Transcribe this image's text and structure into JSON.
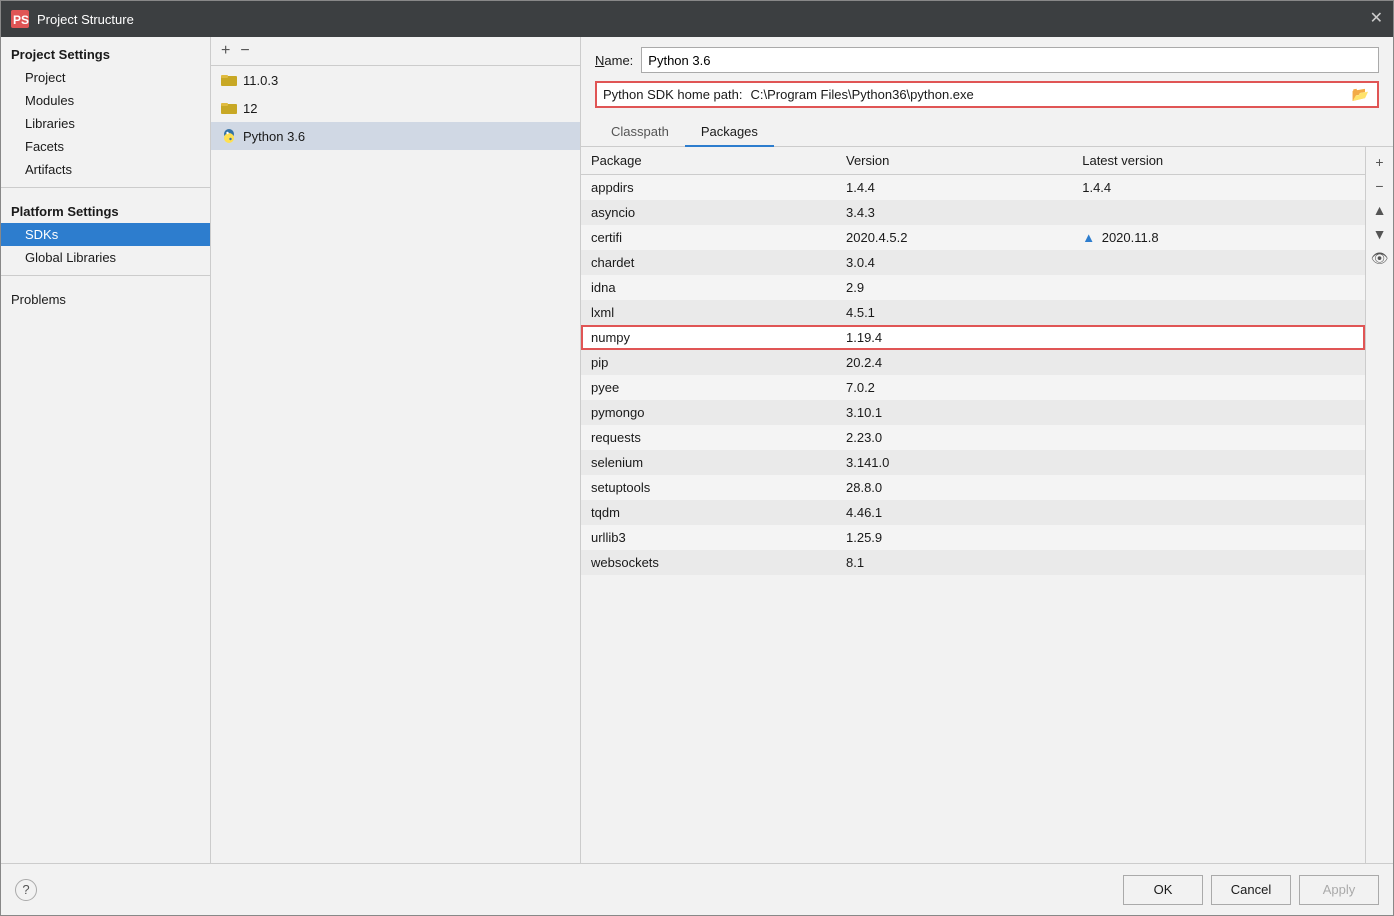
{
  "titleBar": {
    "title": "Project Structure",
    "closeLabel": "✕"
  },
  "sidebar": {
    "projectSettingsLabel": "Project Settings",
    "items": [
      {
        "id": "project",
        "label": "Project"
      },
      {
        "id": "modules",
        "label": "Modules"
      },
      {
        "id": "libraries",
        "label": "Libraries"
      },
      {
        "id": "facets",
        "label": "Facets"
      },
      {
        "id": "artifacts",
        "label": "Artifacts"
      }
    ],
    "platformSettingsLabel": "Platform Settings",
    "platformItems": [
      {
        "id": "sdks",
        "label": "SDKs",
        "active": true
      },
      {
        "id": "global-libraries",
        "label": "Global Libraries"
      }
    ],
    "problemsLabel": "Problems"
  },
  "sdkList": {
    "addLabel": "+",
    "removeLabel": "−",
    "items": [
      {
        "id": "11.0.3",
        "label": "11.0.3",
        "type": "folder"
      },
      {
        "id": "12",
        "label": "12",
        "type": "folder"
      },
      {
        "id": "python3.6",
        "label": "Python 3.6",
        "type": "python",
        "selected": true
      }
    ]
  },
  "details": {
    "nameLabel": "Name:",
    "nameValue": "Python 3.6",
    "sdkPathLabel": "Python SDK home path:",
    "sdkPathValue": "C:\\Program Files\\Python36\\python.exe",
    "tabs": [
      {
        "id": "classpath",
        "label": "Classpath"
      },
      {
        "id": "packages",
        "label": "Packages",
        "active": true
      }
    ],
    "tableHeaders": [
      "Package",
      "Version",
      "Latest version"
    ],
    "packages": [
      {
        "name": "appdirs",
        "version": "1.4.4",
        "latest": "1.4.4",
        "highlighted": false
      },
      {
        "name": "asyncio",
        "version": "3.4.3",
        "latest": "",
        "highlighted": false
      },
      {
        "name": "certifi",
        "version": "2020.4.5.2",
        "latest": "▲ 2020.11.8",
        "highlighted": false
      },
      {
        "name": "chardet",
        "version": "3.0.4",
        "latest": "",
        "highlighted": false
      },
      {
        "name": "idna",
        "version": "2.9",
        "latest": "",
        "highlighted": false
      },
      {
        "name": "lxml",
        "version": "4.5.1",
        "latest": "",
        "highlighted": false
      },
      {
        "name": "numpy",
        "version": "1.19.4",
        "latest": "",
        "highlighted": true
      },
      {
        "name": "pip",
        "version": "20.2.4",
        "latest": "",
        "highlighted": false
      },
      {
        "name": "pyee",
        "version": "7.0.2",
        "latest": "",
        "highlighted": false
      },
      {
        "name": "pymongo",
        "version": "3.10.1",
        "latest": "",
        "highlighted": false
      },
      {
        "name": "requests",
        "version": "2.23.0",
        "latest": "",
        "highlighted": false
      },
      {
        "name": "selenium",
        "version": "3.141.0",
        "latest": "",
        "highlighted": false
      },
      {
        "name": "setuptools",
        "version": "28.8.0",
        "latest": "",
        "highlighted": false
      },
      {
        "name": "tqdm",
        "version": "4.46.1",
        "latest": "",
        "highlighted": false
      },
      {
        "name": "urllib3",
        "version": "1.25.9",
        "latest": "",
        "highlighted": false
      },
      {
        "name": "websockets",
        "version": "8.1",
        "latest": "",
        "highlighted": false
      }
    ],
    "sideButtons": [
      "+",
      "−",
      "▲",
      "▼",
      "👁"
    ]
  },
  "bottomBar": {
    "helpLabel": "?",
    "okLabel": "OK",
    "cancelLabel": "Cancel",
    "applyLabel": "Apply"
  }
}
